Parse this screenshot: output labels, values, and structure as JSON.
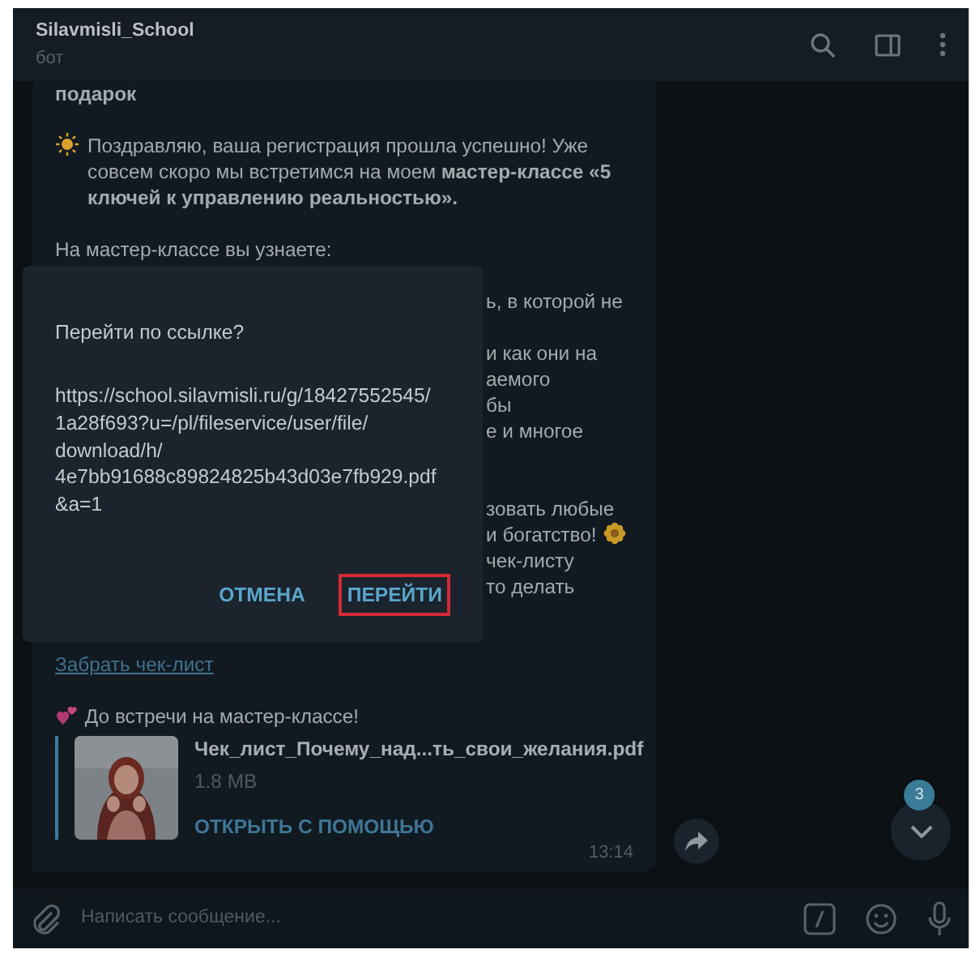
{
  "header": {
    "title": "Silavmisli_School",
    "subtitle": "бот"
  },
  "message": {
    "paragraphs": [
      {
        "kind": "bold",
        "lines": [
          "подарок"
        ]
      },
      {
        "kind": "rich",
        "lines": [
          "Поздравляю, ваша регистрация прошла успешно! Уже совсем скоро мы встретимся на моем **мастер-классе «5 ключей к управлению реальностью».**"
        ]
      },
      {
        "kind": "text",
        "lines": [
          "На мастер-классе вы узнаете:"
        ]
      },
      {
        "kind": "fragment",
        "lines": [
          "ь, в которой не"
        ]
      },
      {
        "kind": "fragment",
        "lines": [
          "и как они на",
          "аемого",
          "бы",
          "е и многое"
        ]
      },
      {
        "kind": "fragment",
        "lines": [
          "зовать любые",
          "и богатство!",
          "чек-листу",
          "то делать"
        ]
      },
      {
        "kind": "link",
        "lines": [
          "Забрать чек-лист"
        ]
      },
      {
        "kind": "text",
        "lines": [
          "До встречи на мастер-классе!"
        ]
      }
    ],
    "file": {
      "name": "Чек_лист_Почему_над...ть_свои_желания.pdf",
      "size": "1.8 MB",
      "action": "ОТКРЫТЬ С ПОМОЩЬЮ"
    },
    "time": "13:14"
  },
  "scroll_badge": "3",
  "composer": {
    "placeholder": "Написать сообщение..."
  },
  "dialog": {
    "title": "Перейти по ссылке?",
    "url": "https://school.silavmisli.ru/g/18427552545/1a28f693?u=/pl/fileservice/user/file/download/h/4e7bb91688c89824825b43d03e7fb929.pdf&a=1",
    "buttons": [
      {
        "label": "ОТМЕНА",
        "highlighted": false
      },
      {
        "label": "ПЕРЕЙТИ",
        "highlighted": true
      }
    ]
  }
}
